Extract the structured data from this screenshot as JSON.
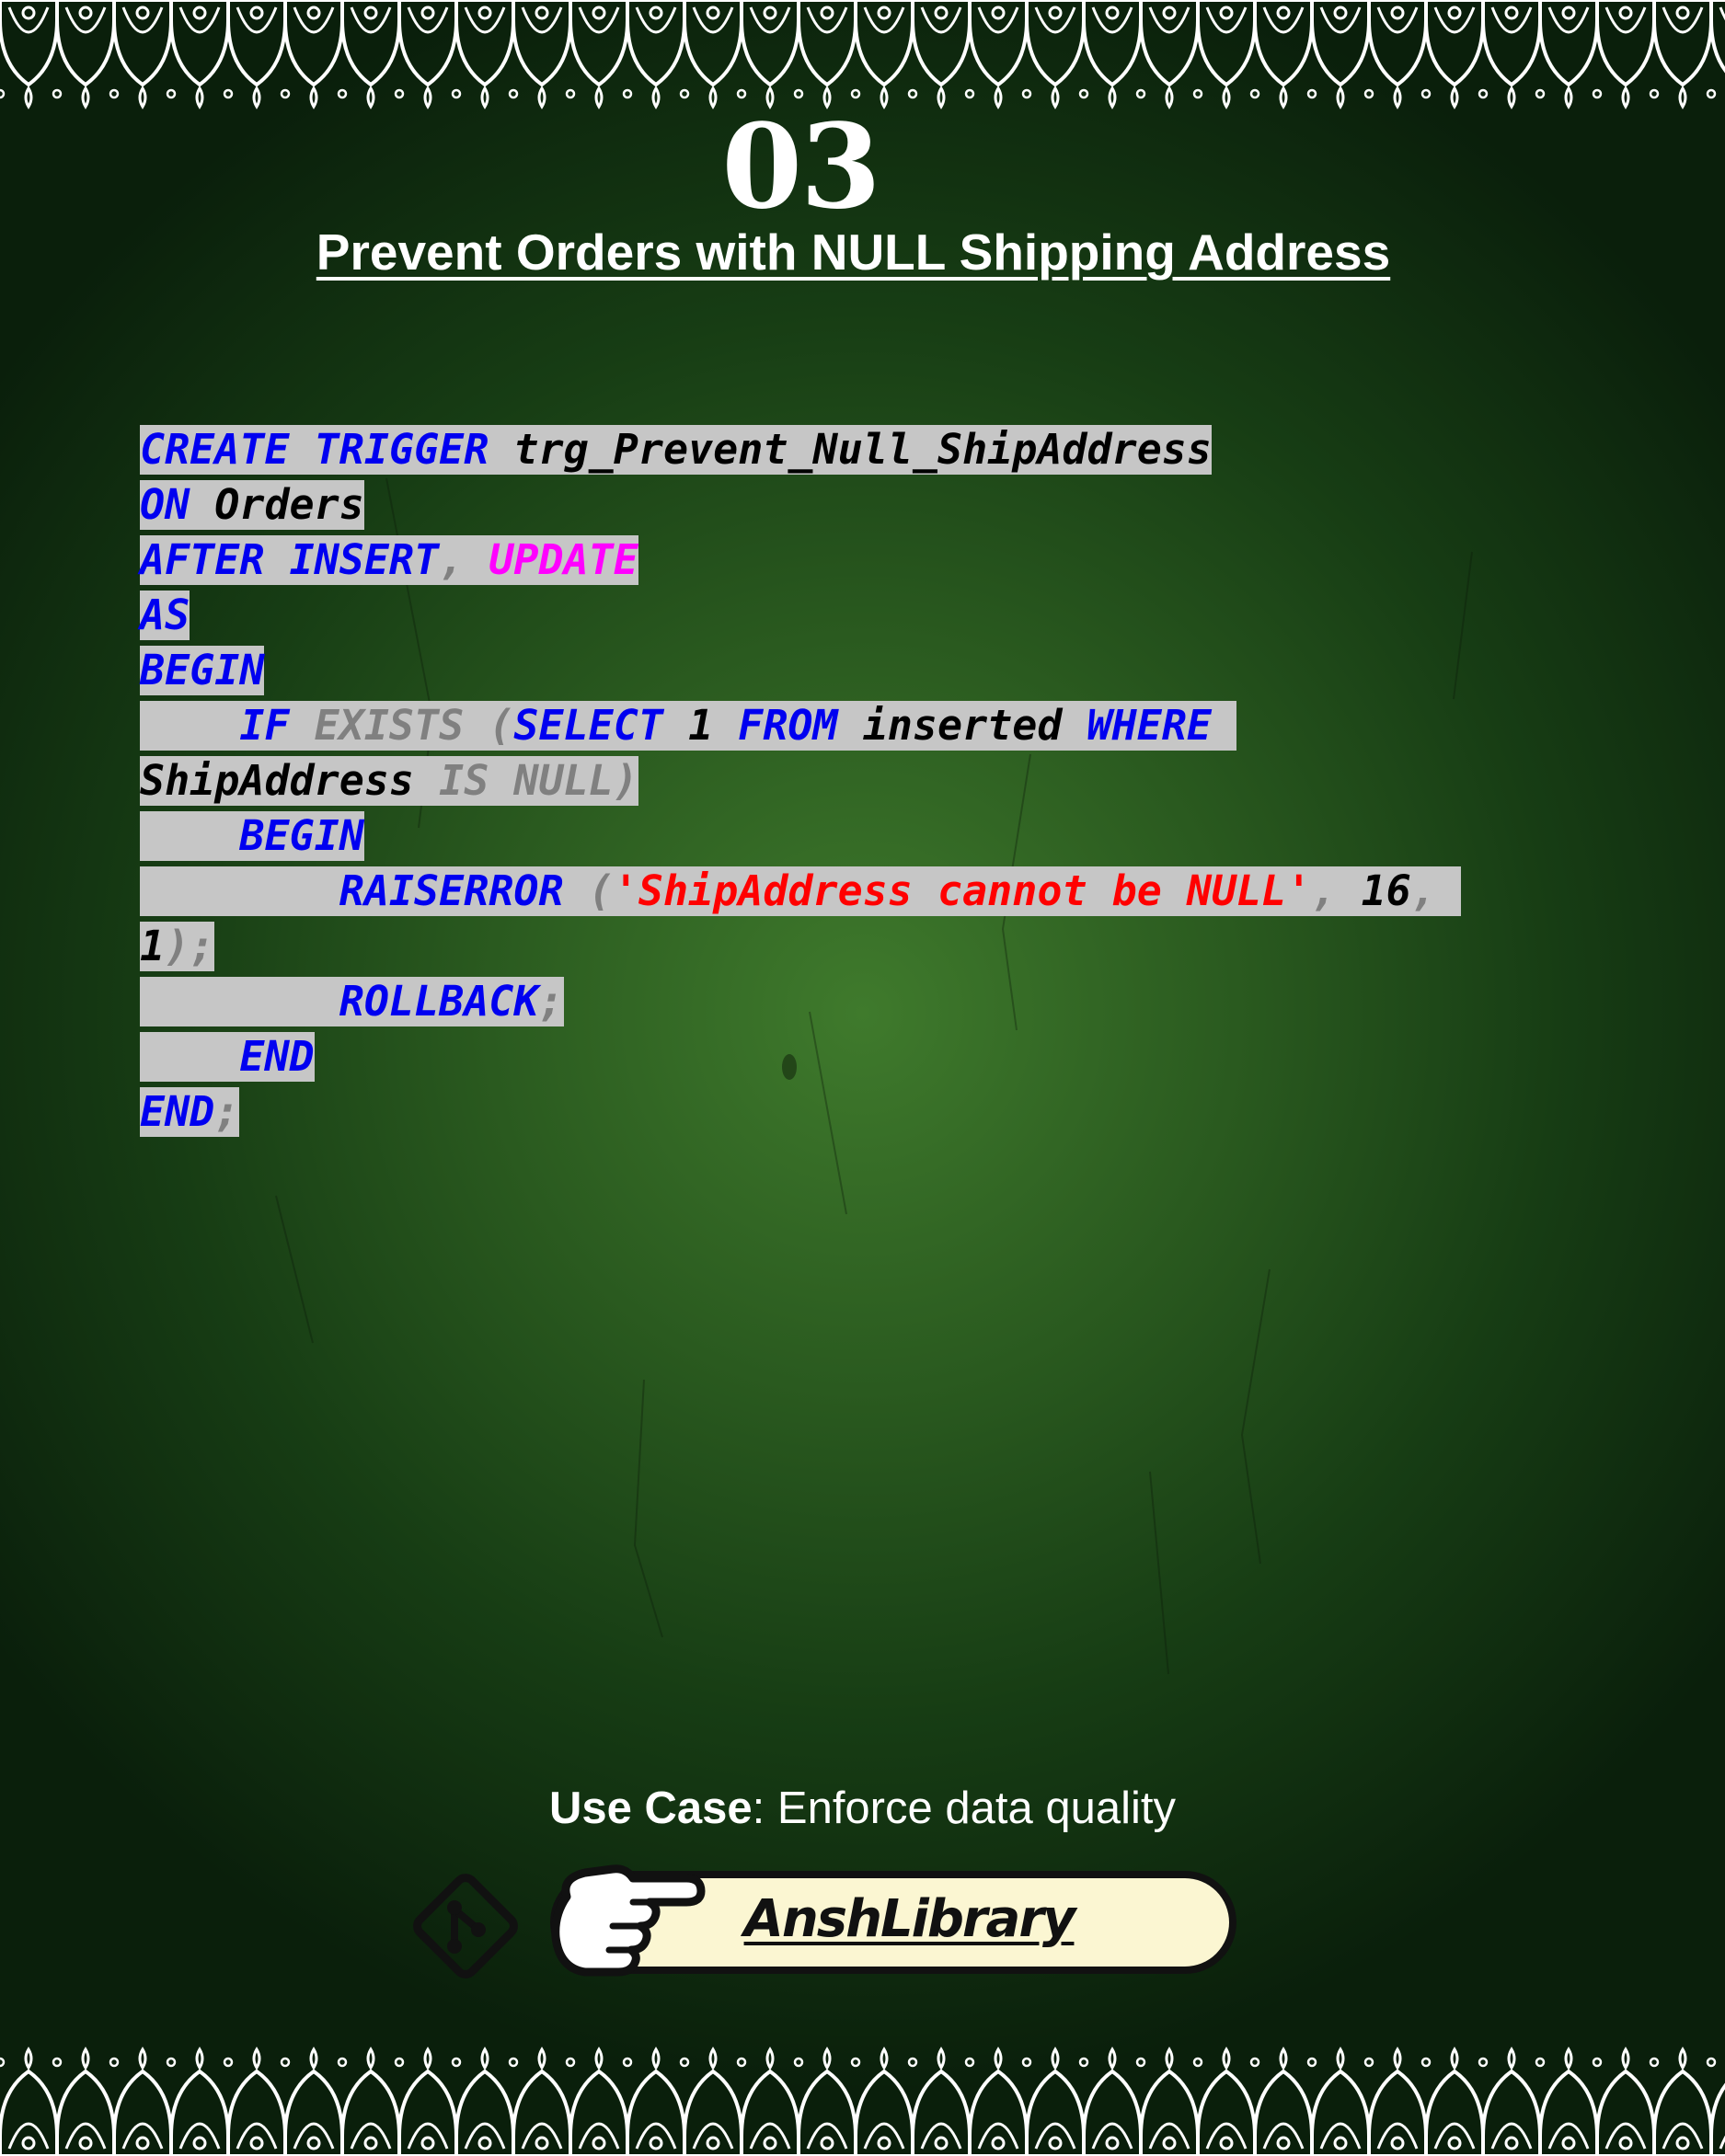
{
  "colors": {
    "keyword": "#0000f0",
    "identifier": "#000000",
    "operator": "#808080",
    "magenta": "#ff00ff",
    "string": "#ff0000",
    "code_bg": "#c6c6c6",
    "pill_bg": "#fbf6d2"
  },
  "header": {
    "number": "03",
    "title": "Prevent Orders with NULL Shipping Address"
  },
  "code_lines": [
    [
      {
        "t": "CREATE",
        "c": "kw"
      },
      {
        "t": " ",
        "c": "plain"
      },
      {
        "t": "TRIGGER",
        "c": "kw"
      },
      {
        "t": " ",
        "c": "plain"
      },
      {
        "t": "trg_Prevent_Null_ShipAddress",
        "c": "id"
      }
    ],
    [
      {
        "t": "ON",
        "c": "kw"
      },
      {
        "t": " ",
        "c": "plain"
      },
      {
        "t": "Orders",
        "c": "id"
      }
    ],
    [
      {
        "t": "AFTER",
        "c": "kw"
      },
      {
        "t": " ",
        "c": "plain"
      },
      {
        "t": "INSERT",
        "c": "kw"
      },
      {
        "t": ", ",
        "c": "gray"
      },
      {
        "t": "UPDATE",
        "c": "mag"
      }
    ],
    [
      {
        "t": "AS",
        "c": "kw"
      }
    ],
    [
      {
        "t": "BEGIN",
        "c": "kw"
      }
    ],
    [
      {
        "t": "    ",
        "c": "plain"
      },
      {
        "t": "IF",
        "c": "kw"
      },
      {
        "t": " ",
        "c": "plain"
      },
      {
        "t": "EXISTS",
        "c": "gray"
      },
      {
        "t": " (",
        "c": "gray"
      },
      {
        "t": "SELECT",
        "c": "kw"
      },
      {
        "t": " ",
        "c": "plain"
      },
      {
        "t": "1",
        "c": "num"
      },
      {
        "t": " ",
        "c": "plain"
      },
      {
        "t": "FROM",
        "c": "kw"
      },
      {
        "t": " ",
        "c": "plain"
      },
      {
        "t": "inserted",
        "c": "id"
      },
      {
        "t": " ",
        "c": "plain"
      },
      {
        "t": "WHERE",
        "c": "kw"
      },
      {
        "t": " ",
        "c": "plain"
      }
    ],
    [
      {
        "t": "ShipAddress",
        "c": "id"
      },
      {
        "t": " ",
        "c": "plain"
      },
      {
        "t": "IS",
        "c": "gray"
      },
      {
        "t": " ",
        "c": "plain"
      },
      {
        "t": "NULL",
        "c": "gray"
      },
      {
        "t": ")",
        "c": "gray"
      }
    ],
    [
      {
        "t": "    ",
        "c": "plain"
      },
      {
        "t": "BEGIN",
        "c": "kw"
      }
    ],
    [
      {
        "t": "        ",
        "c": "plain"
      },
      {
        "t": "RAISERROR",
        "c": "kw"
      },
      {
        "t": " (",
        "c": "gray"
      },
      {
        "t": "'ShipAddress cannot be NULL'",
        "c": "str"
      },
      {
        "t": ", ",
        "c": "gray"
      },
      {
        "t": "16",
        "c": "num"
      },
      {
        "t": ", ",
        "c": "gray"
      }
    ],
    [
      {
        "t": "1",
        "c": "num"
      },
      {
        "t": ");",
        "c": "gray"
      }
    ],
    [
      {
        "t": "        ",
        "c": "plain"
      },
      {
        "t": "ROLLBACK",
        "c": "kw"
      },
      {
        "t": ";",
        "c": "gray"
      }
    ],
    [
      {
        "t": "    ",
        "c": "plain"
      },
      {
        "t": "END",
        "c": "kw"
      }
    ],
    [
      {
        "t": "END",
        "c": "kw"
      },
      {
        "t": ";",
        "c": "gray"
      }
    ]
  ],
  "use_case": {
    "label": "Use Case",
    "text": ": Enforce data quality"
  },
  "brand": {
    "name": "AnshLibrary",
    "icons": [
      "git-icon",
      "pointing-hand-icon"
    ]
  }
}
